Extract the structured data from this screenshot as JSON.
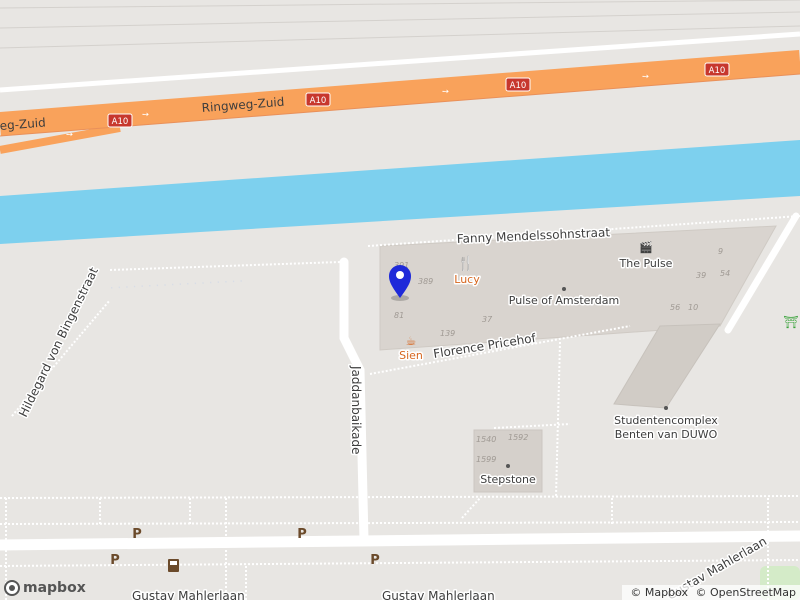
{
  "map": {
    "roads": {
      "ringweg": "Ringweg-Zuid",
      "ringweg_partial": "eg-Zuid",
      "fanny": "Fanny Mendelssohnstraat",
      "jaddanbaikade": "Jaddanbaikade",
      "hildegard": "Hildegard von Bingenstraat",
      "florence": "Florence Pricehof",
      "gustav_1": "Gustav Mahlerlaan",
      "gustav_2": "Gustav Mahlerlaan",
      "gustav_3": "Gustav Mahlerlaan"
    },
    "shields": [
      "A10",
      "A10",
      "A10",
      "A10"
    ],
    "pois": {
      "lucy": "Lucy",
      "sien": "Sien",
      "the_pulse": "The Pulse",
      "pulse_amsterdam": "Pulse of Amsterdam",
      "studenten_1": "Studentencomplex",
      "studenten_2": "Benten van DUWO",
      "stepstone": "Stepstone"
    },
    "house_numbers": [
      "391",
      "389",
      "81",
      "139",
      "37",
      "9",
      "39",
      "54",
      "56",
      "10",
      "1540",
      "1592",
      "1599"
    ],
    "parking": [
      "P",
      "P",
      "P",
      "P"
    ],
    "colors": {
      "motorway": "#f9a25b",
      "water": "#7dd0ee",
      "building": "#d9d4cf",
      "ground": "#e8e6e3",
      "marker": "#1f2ad9",
      "poi_food": "#d6661f",
      "park_icon": "#39a33a"
    },
    "icons": [
      "map-pin-icon",
      "restaurant-icon",
      "cafe-icon",
      "cinema-icon",
      "parking-icon",
      "fuel-icon",
      "picnic-icon"
    ]
  },
  "attribution": {
    "mapbox": "© Mapbox",
    "osm": "© OpenStreetMap",
    "logo": "mapbox"
  }
}
